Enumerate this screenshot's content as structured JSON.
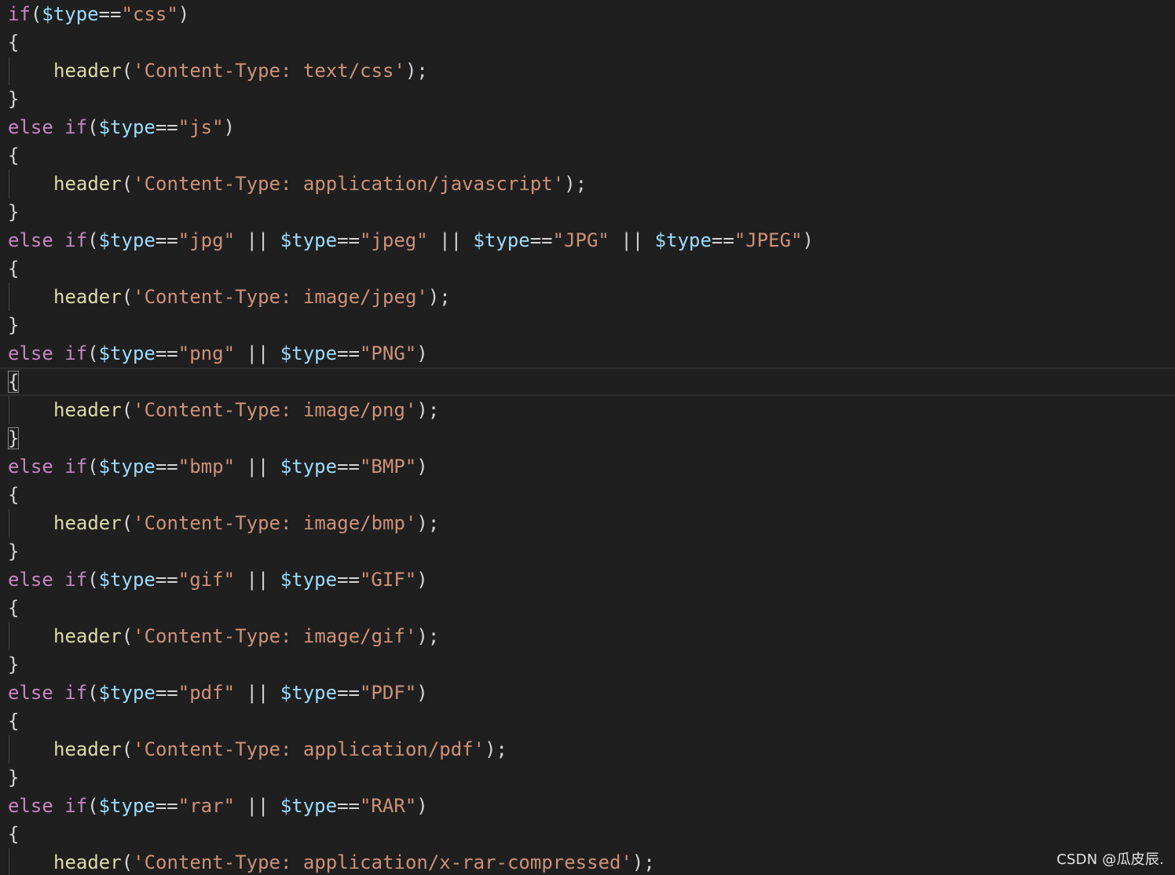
{
  "lines": [
    {
      "kind": "cond",
      "prefix": "",
      "keyword": "if",
      "pairs": [
        {
          "var": "$type",
          "str": "\"css\""
        }
      ]
    },
    {
      "kind": "open"
    },
    {
      "kind": "body",
      "fn": "header",
      "arg": "'Content-Type: text/css'"
    },
    {
      "kind": "close"
    },
    {
      "kind": "cond",
      "prefix": "else",
      "keyword": "if",
      "pairs": [
        {
          "var": "$type",
          "str": "\"js\""
        }
      ]
    },
    {
      "kind": "open"
    },
    {
      "kind": "body",
      "fn": "header",
      "arg": "'Content-Type: application/javascript'"
    },
    {
      "kind": "close"
    },
    {
      "kind": "cond",
      "prefix": "else",
      "keyword": "if",
      "pairs": [
        {
          "var": "$type",
          "str": "\"jpg\""
        },
        {
          "var": "$type",
          "str": "\"jpeg\""
        },
        {
          "var": "$type",
          "str": "\"JPG\""
        },
        {
          "var": "$type",
          "str": "\"JPEG\""
        }
      ]
    },
    {
      "kind": "open"
    },
    {
      "kind": "body",
      "fn": "header",
      "arg": "'Content-Type: image/jpeg'"
    },
    {
      "kind": "close"
    },
    {
      "kind": "cond",
      "prefix": "else",
      "keyword": "if",
      "pairs": [
        {
          "var": "$type",
          "str": "\"png\""
        },
        {
          "var": "$type",
          "str": "\"PNG\""
        }
      ]
    },
    {
      "kind": "open",
      "current": true,
      "match": true
    },
    {
      "kind": "body",
      "fn": "header",
      "arg": "'Content-Type: image/png'"
    },
    {
      "kind": "close",
      "match": true
    },
    {
      "kind": "cond",
      "prefix": "else",
      "keyword": "if",
      "pairs": [
        {
          "var": "$type",
          "str": "\"bmp\""
        },
        {
          "var": "$type",
          "str": "\"BMP\""
        }
      ]
    },
    {
      "kind": "open"
    },
    {
      "kind": "body",
      "fn": "header",
      "arg": "'Content-Type: image/bmp'"
    },
    {
      "kind": "close"
    },
    {
      "kind": "cond",
      "prefix": "else",
      "keyword": "if",
      "pairs": [
        {
          "var": "$type",
          "str": "\"gif\""
        },
        {
          "var": "$type",
          "str": "\"GIF\""
        }
      ]
    },
    {
      "kind": "open"
    },
    {
      "kind": "body",
      "fn": "header",
      "arg": "'Content-Type: image/gif'"
    },
    {
      "kind": "close"
    },
    {
      "kind": "cond",
      "prefix": "else",
      "keyword": "if",
      "pairs": [
        {
          "var": "$type",
          "str": "\"pdf\""
        },
        {
          "var": "$type",
          "str": "\"PDF\""
        }
      ]
    },
    {
      "kind": "open"
    },
    {
      "kind": "body",
      "fn": "header",
      "arg": "'Content-Type: application/pdf'"
    },
    {
      "kind": "close"
    },
    {
      "kind": "cond",
      "prefix": "else",
      "keyword": "if",
      "pairs": [
        {
          "var": "$type",
          "str": "\"rar\""
        },
        {
          "var": "$type",
          "str": "\"RAR\""
        }
      ]
    },
    {
      "kind": "open"
    },
    {
      "kind": "body",
      "fn": "header",
      "arg": "'Content-Type: application/x-rar-compressed'"
    }
  ],
  "syntax": {
    "open_brace": "{",
    "close_brace": "}",
    "paren_open": "(",
    "paren_close": ")",
    "equals": "==",
    "or": " || ",
    "terminator": ");"
  },
  "watermark": "CSDN @瓜皮辰.",
  "colors": {
    "background": "#1f1f1f",
    "keyword": "#c586c0",
    "variable": "#9cdcfe",
    "function": "#dcdcaa",
    "string": "#ce9178",
    "text": "#d4d4d4"
  }
}
